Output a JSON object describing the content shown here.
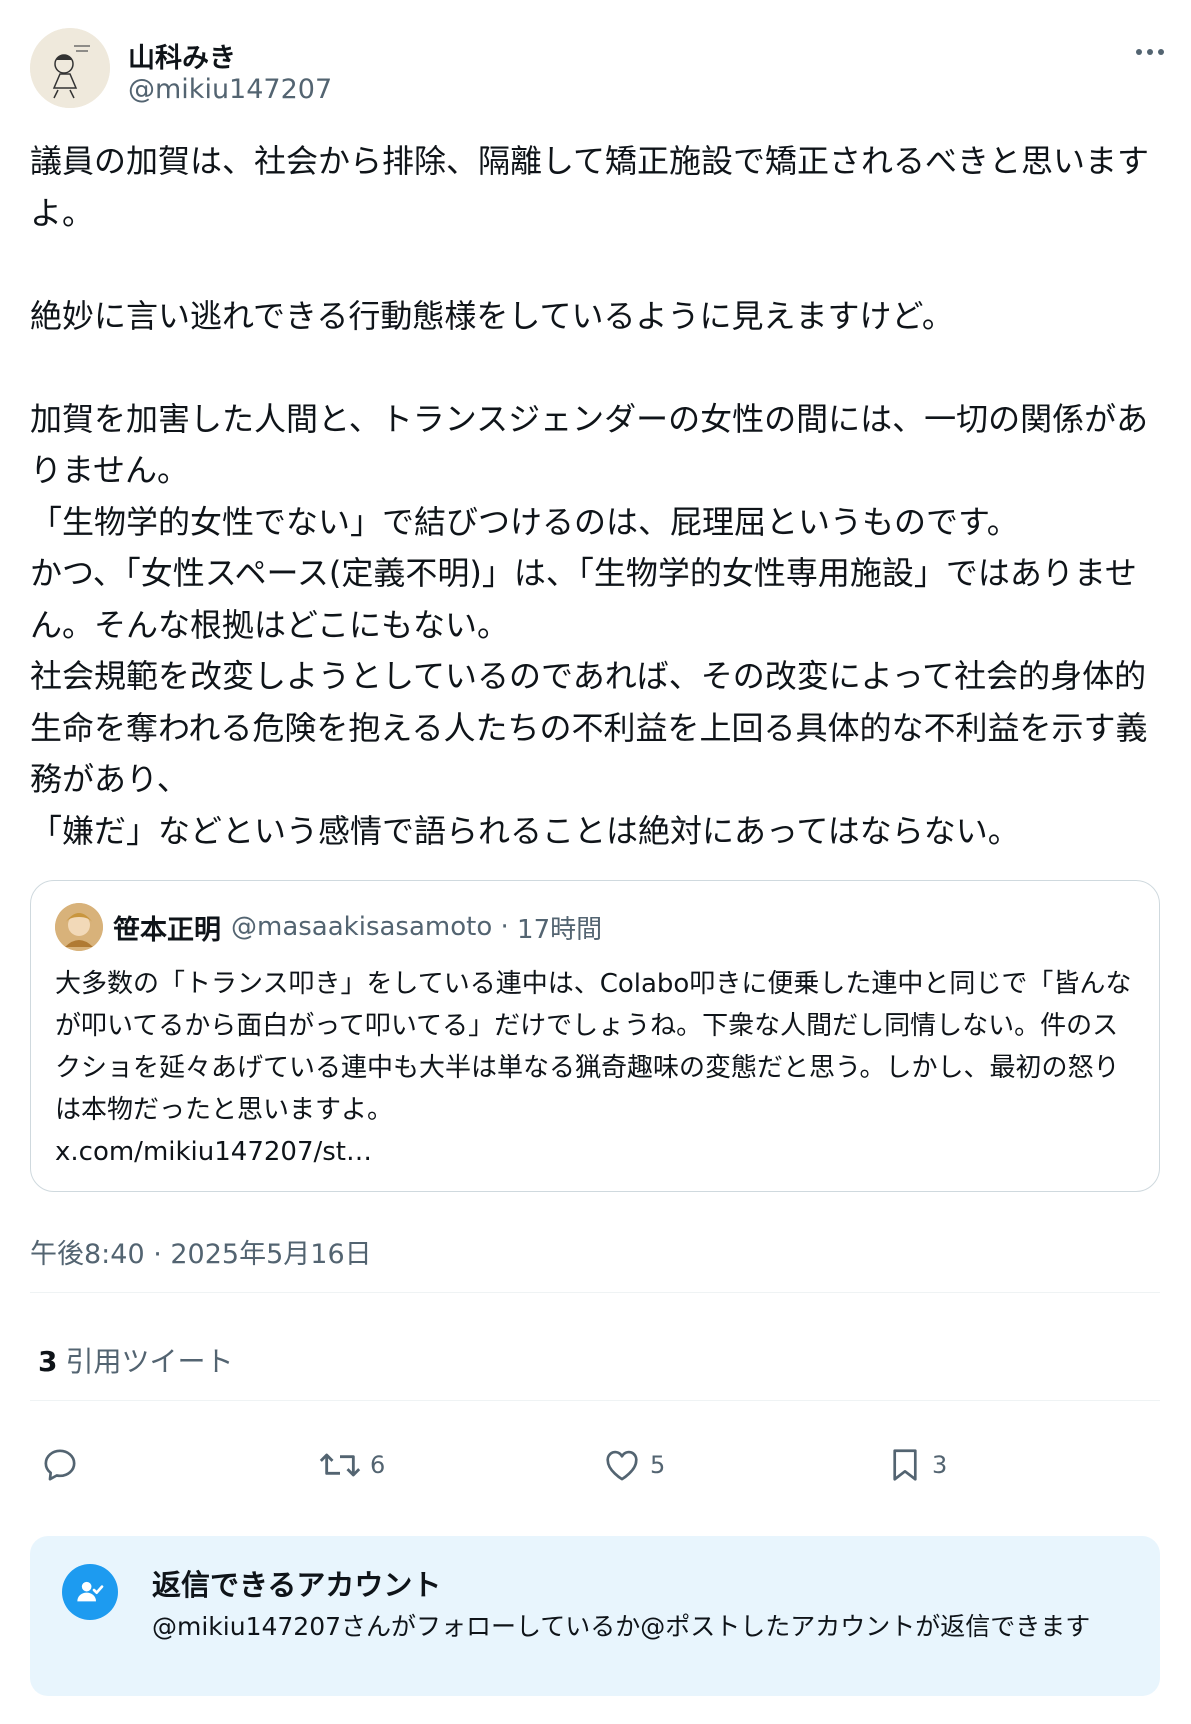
{
  "author": {
    "name": "山科みき",
    "handle": "@mikiu147207"
  },
  "tweet": {
    "text": "議員の加賀は、社会から排除、隔離して矯正施設で矯正されるべきと思いますよ。\n\n絶妙に言い逃れできる行動態様をしているように見えますけど。\n\n加賀を加害した人間と、トランスジェンダーの女性の間には、一切の関係がありません。\n「生物学的女性でない」で結びつけるのは、屁理屈というものです。\nかつ、「女性スペース(定義不明)」は、「生物学的女性専用施設」ではありません。そんな根拠はどこにもない。\n社会規範を改変しようとしているのであれば、その改変によって社会的身体的生命を奪われる危険を抱える人たちの不利益を上回る具体的な不利益を示す義務があり、\n「嫌だ」などという感情で語られることは絶対にあってはならない。",
    "timestamp": "午後8:40 · 2025年5月16日"
  },
  "quoted_tweet": {
    "name": "笹本正明",
    "handle": "@masaakisasamoto",
    "time": "17時間",
    "separator": " · ",
    "text": "大多数の「トランス叩き」をしている連中は、Colabo叩きに便乗した連中と同じで「皆んなが叩いてるから面白がって叩いてる」だけでしょうね。下衆な人間だし同情しない。件のスクショを延々あげている連中も大半は単なる猟奇趣味の変態だと思う。しかし、最初の怒りは本物だったと思いますよ。",
    "link": "x.com/mikiu147207/st…"
  },
  "stats": {
    "quotes_count": "3",
    "quotes_label": "引用ツイート"
  },
  "actions": {
    "reply_icon": "reply-icon",
    "retweet_icon": "retweet-icon",
    "retweet_count": "6",
    "like_icon": "heart-icon",
    "like_count": "5",
    "bookmark_icon": "bookmark-icon",
    "bookmark_count": "3"
  },
  "reply_restriction": {
    "title": "返信できるアカウント",
    "description": "@mikiu147207さんがフォローしているか@ポストしたアカウントが返信できます"
  },
  "colors": {
    "accent": "#1d9bf0",
    "secondary_text": "#536471",
    "border": "#cfd9de",
    "info_bg": "#e8f5fd"
  }
}
